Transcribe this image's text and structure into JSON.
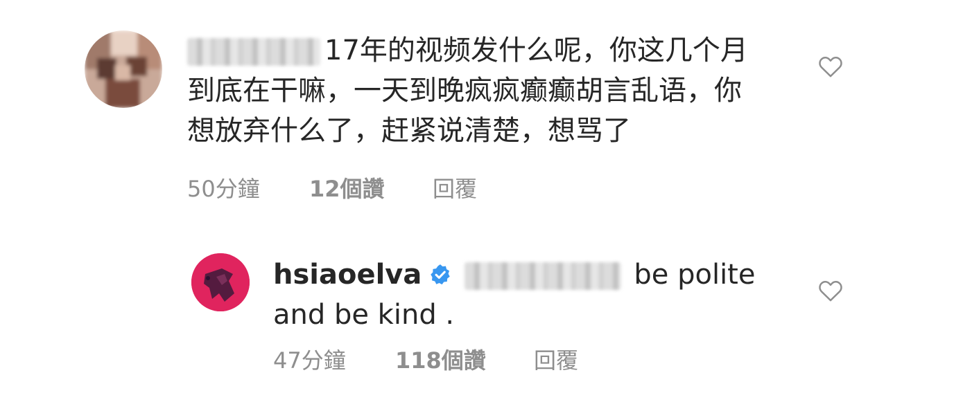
{
  "comments": [
    {
      "text_lines": [
        "17年的视频发什么呢，你这几个月",
        "到底在干嘛，一天到晚疯疯癫癫胡言乱语，你",
        "想放弃什么了，赶紧说清楚，想骂了"
      ],
      "time": "50分鐘",
      "likes": "12個讚",
      "reply_label": "回覆",
      "icons": {
        "avatar": "blurred-avatar",
        "like": "heart-outline-icon"
      }
    },
    {
      "username": "hsiaoelva",
      "text_line1": "be polite",
      "text_line2": "and be kind .",
      "time": "47分鐘",
      "likes": "118個讚",
      "reply_label": "回覆",
      "icons": {
        "verified": "verified-badge-icon",
        "like": "heart-outline-icon"
      }
    }
  ],
  "colors": {
    "text": "#262626",
    "meta": "#8e8e8e",
    "verified": "#3897f0",
    "avatar_reply": "#e0245e"
  }
}
